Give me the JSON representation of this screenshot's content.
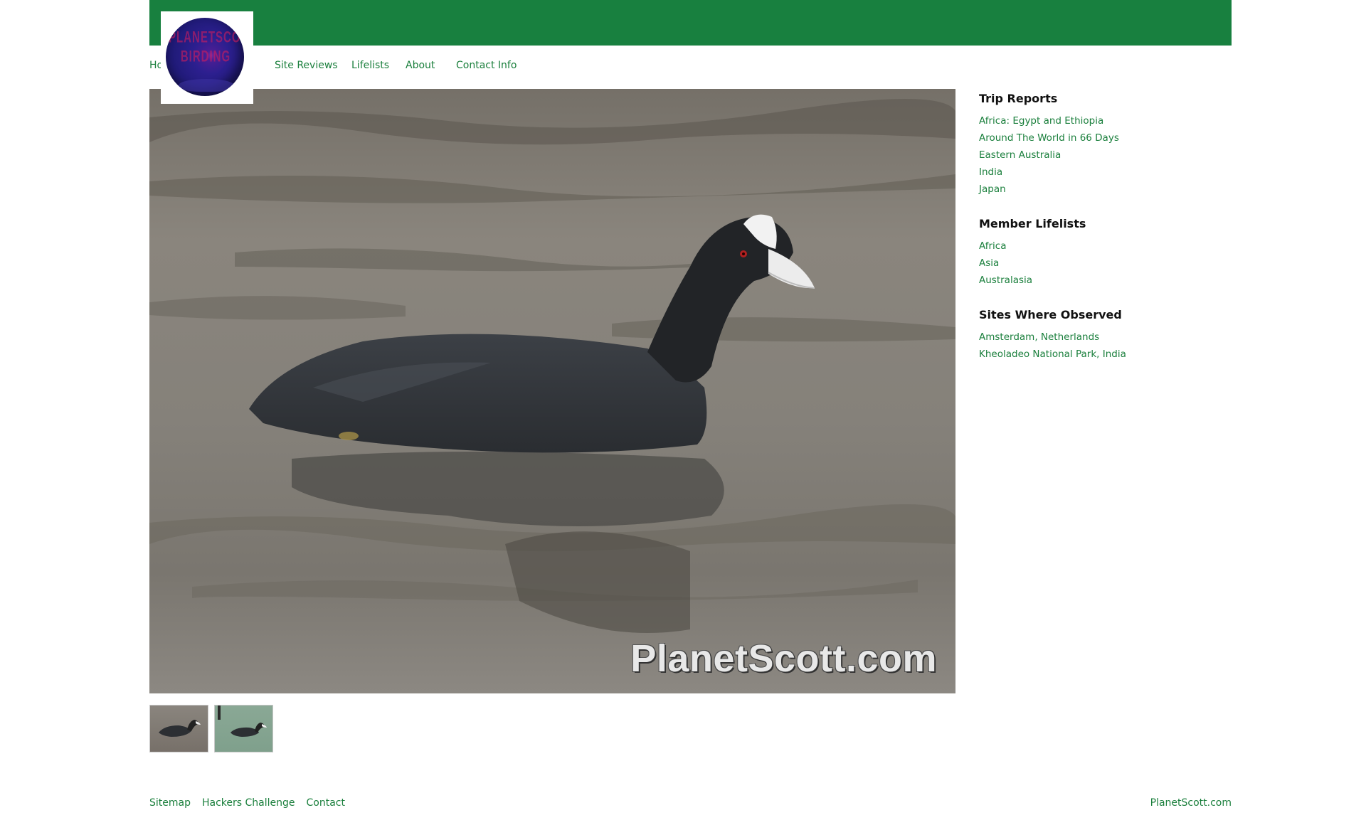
{
  "logo": {
    "text": "PLANETSCOTT\nBIRDING"
  },
  "nav": {
    "items": [
      {
        "label": "Home"
      },
      {
        "label": "Site Reviews"
      },
      {
        "label": "Lifelists"
      },
      {
        "label": "About"
      },
      {
        "label": "Contact Info"
      }
    ]
  },
  "photo": {
    "watermark": "PlanetScott.com",
    "subject": "coot-swimming"
  },
  "thumbnails": [
    {
      "subject": "coot-in-water"
    },
    {
      "subject": "coot-in-water-2"
    }
  ],
  "sidebar": {
    "sections": [
      {
        "heading": "Trip Reports",
        "links": [
          "Africa: Egypt and Ethiopia",
          "Around The World in 66 Days",
          "Eastern Australia",
          "India",
          "Japan"
        ]
      },
      {
        "heading": "Member Lifelists",
        "links": [
          "Africa",
          "Asia",
          "Australasia"
        ]
      },
      {
        "heading": "Sites Where Observed",
        "links": [
          "Amsterdam, Netherlands",
          "Kheoladeo National Park, India"
        ]
      }
    ]
  },
  "footer": {
    "links": [
      "Sitemap",
      "Hackers Challenge",
      "Contact"
    ],
    "right": "PlanetScott.com"
  },
  "colors": {
    "brand_green": "#18803f",
    "link_green": "#1a7f3c",
    "heading": "#111111"
  }
}
